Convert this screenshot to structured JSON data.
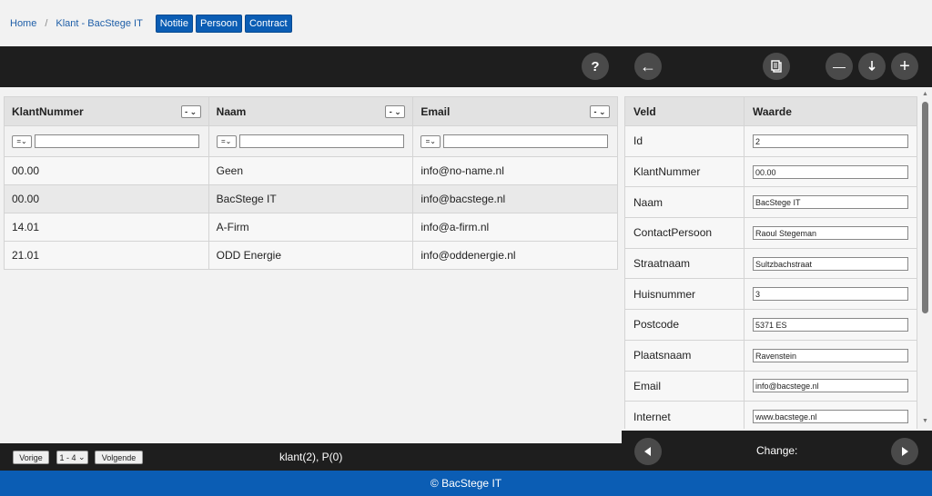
{
  "breadcrumb": {
    "home": "Home",
    "separator": "/",
    "current": "Klant - BacStege IT"
  },
  "tabs": [
    "Notitie",
    "Persoon",
    "Contract"
  ],
  "toolbar": {
    "help": "?",
    "back": "←",
    "minus": "—",
    "plus": "+"
  },
  "grid": {
    "columns": [
      "KlantNummer",
      "Naam",
      "Email"
    ],
    "header_select": "-",
    "filter_op": "=",
    "rows": [
      [
        "00.00",
        "Geen",
        "info@no-name.nl"
      ],
      [
        "00.00",
        "BacStege IT",
        "info@bacstege.nl"
      ],
      [
        "14.01",
        "A-Firm",
        "info@a-firm.nl"
      ],
      [
        "21.01",
        "ODD Energie",
        "info@oddenergie.nl"
      ]
    ]
  },
  "detail": {
    "headers": [
      "Veld",
      "Waarde"
    ],
    "fields": [
      {
        "label": "Id",
        "value": "2"
      },
      {
        "label": "KlantNummer",
        "value": "00.00"
      },
      {
        "label": "Naam",
        "value": "BacStege IT"
      },
      {
        "label": "ContactPersoon",
        "value": "Raoul Stegeman"
      },
      {
        "label": "Straatnaam",
        "value": "Sultzbachstraat"
      },
      {
        "label": "Huisnummer",
        "value": "3"
      },
      {
        "label": "Postcode",
        "value": "5371 ES"
      },
      {
        "label": "Plaatsnaam",
        "value": "Ravenstein"
      },
      {
        "label": "Email",
        "value": "info@bacstege.nl"
      },
      {
        "label": "Internet",
        "value": "www.bacstege.nl"
      }
    ]
  },
  "pager": {
    "prev": "Vorige",
    "range": "1 - 4",
    "next": "Volgende",
    "info": "klant(2), P(0)"
  },
  "changebar": {
    "label": "Change:"
  },
  "footer": {
    "text": "© BacStege IT"
  },
  "colors": {
    "accent": "#0b5db4",
    "toolbar": "#1e1e1e"
  }
}
